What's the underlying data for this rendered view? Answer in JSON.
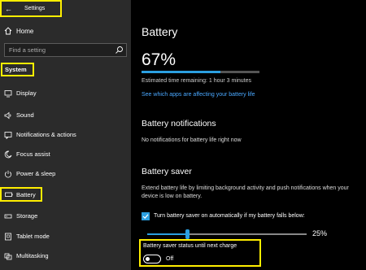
{
  "window": {
    "title": "Settings",
    "back_icon": "back-arrow-icon"
  },
  "sidebar": {
    "home_label": "Home",
    "search_placeholder": "Find a setting",
    "section_label": "System",
    "items": [
      {
        "label": "Display",
        "icon": "display-icon"
      },
      {
        "label": "Sound",
        "icon": "sound-icon"
      },
      {
        "label": "Notifications & actions",
        "icon": "notifications-icon"
      },
      {
        "label": "Focus assist",
        "icon": "moon-icon"
      },
      {
        "label": "Power & sleep",
        "icon": "power-icon"
      },
      {
        "label": "Battery",
        "icon": "battery-icon",
        "selected": true
      },
      {
        "label": "Storage",
        "icon": "storage-icon"
      },
      {
        "label": "Tablet mode",
        "icon": "tablet-icon"
      },
      {
        "label": "Multitasking",
        "icon": "multitasking-icon"
      }
    ]
  },
  "main": {
    "title": "Battery",
    "percent_text": "67%",
    "percent_value": 67,
    "estimate": "Estimated time remaining: 1 hour 3 minutes",
    "apps_link": "See which apps are affecting your battery life",
    "notifications_heading": "Battery notifications",
    "notifications_text": "No notifications for battery life right now",
    "saver_heading": "Battery saver",
    "saver_description": "Extend battery life by limiting background activity and push notifications when your device is low on battery.",
    "auto_saver_label": "Turn battery saver on automatically if my battery falls below:",
    "auto_saver_checked": true,
    "threshold_text": "25%",
    "threshold_value": 25,
    "status_label": "Battery saver status until next charge",
    "status_toggle_text": "Off"
  },
  "colors": {
    "accent": "#2b9fe0",
    "highlight": "#ffee00",
    "sidebar_bg": "#2b2b2b",
    "main_bg": "#000000"
  }
}
